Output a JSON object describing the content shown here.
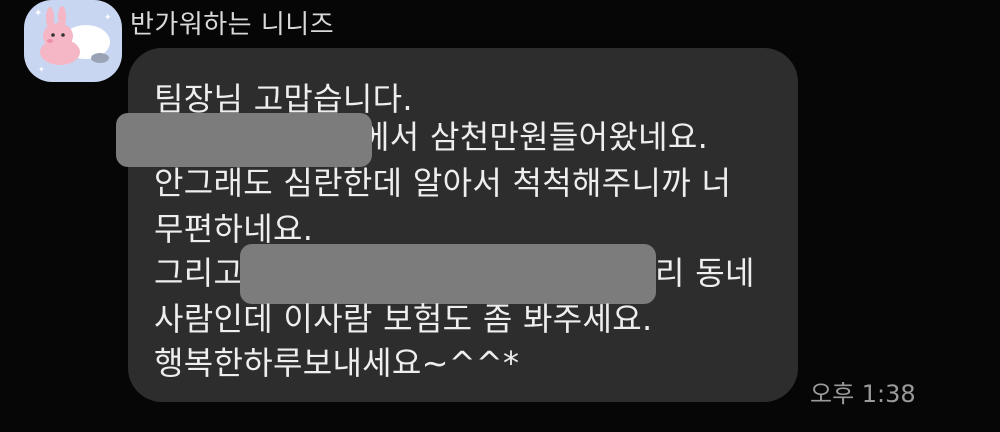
{
  "chat": {
    "sender_name": "반가워하는 니니즈",
    "message": {
      "lines": [
        "팀장님 고맙습니다.",
        "에서 삼천만원들어왔네요.",
        "안그래도 심란한데 알아서 척척해주니까 너",
        "무편하네요.",
        "그리고",
        "리 동네",
        "사람인데 이사람 보험도 좀 봐주세요.",
        "행복한하루보내세요~^^*"
      ]
    },
    "timestamp": "오후 1:38"
  },
  "colors": {
    "background": "#060606",
    "bubble": "#2d2d2d",
    "text": "#eeeeee",
    "redaction": "#7c7c7c",
    "avatar_bg": "#c9d6f2"
  },
  "avatar_icon": "pink-bunny-character-icon"
}
